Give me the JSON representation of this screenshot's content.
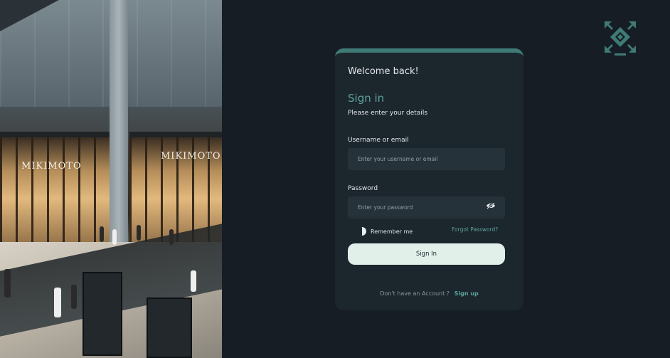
{
  "photo": {
    "store_sign_left": "MIKIMOTO",
    "store_sign_right": "MIKIMOTO"
  },
  "logo": {
    "icon": "arrows-converge-diamond-icon",
    "color": "#3f7a76"
  },
  "card": {
    "welcome": "Welcome back!",
    "title": "Sign in",
    "subtitle": "Please enter your details",
    "username": {
      "label": "Username or email",
      "placeholder": "Enter your username or email",
      "value": ""
    },
    "password": {
      "label": "Password",
      "placeholder": "Enter your password",
      "value": "",
      "toggle_icon": "eye-off-icon"
    },
    "remember_label": "Remember me",
    "forgot_label": "Forgot Password?",
    "submit_label": "Sign In",
    "footer_question": "Don't have an Account ?",
    "footer_link": "Sign up"
  },
  "colors": {
    "background": "#161d24",
    "card": "#1c262d",
    "accent": "#5da39b",
    "card_top_border": "#3f7a76",
    "button": "#e1f1ea",
    "input": "#26323a"
  }
}
